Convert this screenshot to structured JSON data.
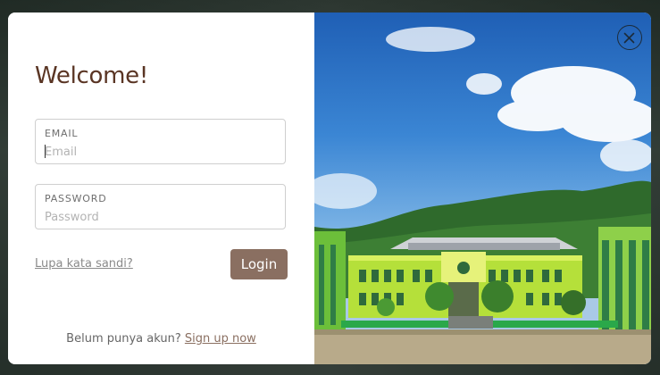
{
  "modal": {
    "title": "Welcome!",
    "email": {
      "label": "EMAIL",
      "placeholder": "Email",
      "value": ""
    },
    "password": {
      "label": "PASSWORD",
      "placeholder": "Password",
      "value": ""
    },
    "forgot_link": "Lupa kata sandi?",
    "login_button": "Login",
    "signup_prompt": "Belum punya akun?",
    "signup_link": "Sign up now"
  },
  "icons": {
    "close": "close-icon"
  },
  "colors": {
    "title": "#5a3524",
    "button": "#8a6f61",
    "link": "#8a8a8a"
  }
}
